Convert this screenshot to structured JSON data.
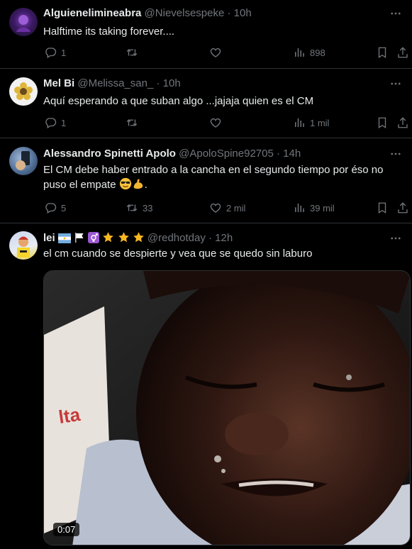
{
  "tweets": [
    {
      "name": "Alguienelimineabra",
      "handle": "@Nievelsespeke",
      "time": "· 10h",
      "text": "Halftime its taking forever....",
      "replies": "1",
      "retweets": "",
      "likes": "",
      "views": "898"
    },
    {
      "name": "Mel Bi",
      "handle": "@Melissa_san_",
      "time": "· 10h",
      "text": "Aquí esperando a que suban algo ...jajaja quien es el CM",
      "replies": "1",
      "retweets": "",
      "likes": "",
      "views": "1 mil"
    },
    {
      "name": "Alessandro Spinetti Apolo",
      "handle": "@ApoloSpine92705",
      "time": "· 14h",
      "text_line1": "El CM debe haber entrado a la cancha en el segundo tiempo por éso no",
      "text_line2": "puso el empate",
      "text_line2_end": ".",
      "replies": "5",
      "retweets": "33",
      "likes": "2 mil",
      "views": "39 mil"
    },
    {
      "name": "lei",
      "handle": "@redhotday",
      "time": "· 12h",
      "text": "el cm cuando se despierte y vea que se quedo sin laburo",
      "video_duration": "0:07"
    }
  ],
  "icons": {
    "reply": "reply-icon",
    "retweet": "retweet-icon",
    "like": "heart-icon",
    "views": "views-icon",
    "bookmark": "bookmark-icon",
    "share": "share-icon",
    "more": "more-icon"
  },
  "colors": {
    "background": "#000000",
    "text": "#e7e9ea",
    "secondary": "#71767b",
    "divider": "#2f3336"
  }
}
